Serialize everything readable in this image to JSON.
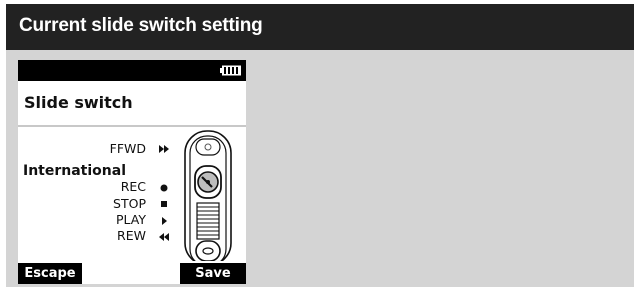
{
  "header": {
    "title": "Current slide switch setting"
  },
  "screen": {
    "title": "Slide switch",
    "group_label": "International",
    "positions": [
      {
        "label": "FFWD",
        "icon": "fast-forward-icon"
      },
      {
        "label": "REC",
        "icon": "record-dot-icon"
      },
      {
        "label": "STOP",
        "icon": "stop-square-icon"
      },
      {
        "label": "PLAY",
        "icon": "play-triangle-icon"
      },
      {
        "label": "REW",
        "icon": "rewind-icon"
      }
    ],
    "battery_icon": "battery-full-icon"
  },
  "softkeys": {
    "left": "Escape",
    "right": "Save"
  },
  "colors": {
    "header_bg": "#222222",
    "panel_bg": "#d4d4d4",
    "screen_bg": "#ffffff"
  }
}
